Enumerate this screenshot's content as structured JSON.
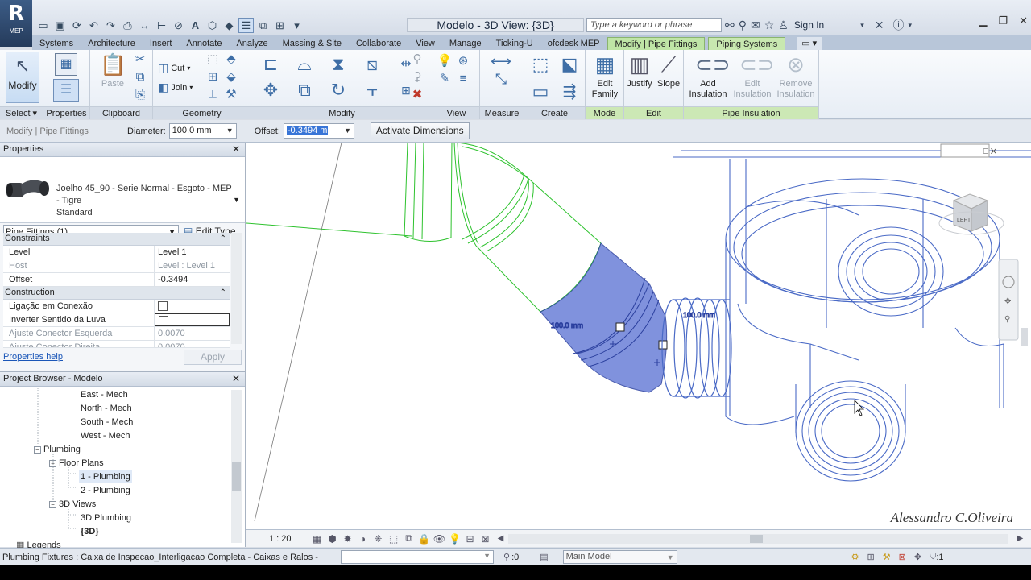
{
  "app": {
    "title": "Modelo - 3D View: {3D}",
    "logo_letter": "R",
    "logo_sub": "MEP",
    "search_placeholder": "Type a keyword or phrase",
    "sign_in": "Sign In"
  },
  "tabs": [
    "Systems",
    "Architecture",
    "Insert",
    "Annotate",
    "Analyze",
    "Massing & Site",
    "Collaborate",
    "View",
    "Manage",
    "Ticking-U",
    "ofcdesk MEP"
  ],
  "context_tabs": [
    "Modify | Pipe Fittings",
    "Piping Systems"
  ],
  "ribbon": {
    "select_panel": {
      "modify_label": "Modify",
      "title": "Select"
    },
    "properties_panel": {
      "title": "Properties"
    },
    "clipboard_panel": {
      "paste_label": "Paste",
      "title": "Clipboard"
    },
    "geometry_panel": {
      "cut_label": "Cut",
      "join_label": "Join",
      "title": "Geometry"
    },
    "modify_panel": {
      "title": "Modify"
    },
    "view_panel": {
      "title": "View"
    },
    "measure_panel": {
      "title": "Measure"
    },
    "create_panel": {
      "title": "Create"
    },
    "mode_panel": {
      "edit_family_label": "Edit Family",
      "title": "Mode"
    },
    "edit_panel": {
      "justify_label": "Justify",
      "slope_label": "Slope",
      "title": "Edit"
    },
    "insulation_panel": {
      "add_label": "Add Insulation",
      "edit_label": "Edit Insulation",
      "remove_label": "Remove Insulation",
      "title": "Pipe Insulation"
    }
  },
  "options_bar": {
    "context": "Modify | Pipe Fittings",
    "diameter_label": "Diameter:",
    "diameter_value": "100.0 mm",
    "offset_label": "Offset:",
    "offset_value": "-0.3494 m",
    "activate_dimensions": "Activate Dimensions"
  },
  "properties": {
    "header": "Properties",
    "type_name": "Joelho 45_90 - Serie Normal - Esgoto - MEP - Tigre",
    "type_sub": "Standard",
    "filter": "Pipe Fittings (1)",
    "edit_type": "Edit Type",
    "groups": [
      {
        "name": "Constraints",
        "rows": [
          {
            "k": "Level",
            "v": "Level 1",
            "grey": false
          },
          {
            "k": "Host",
            "v": "Level : Level 1",
            "grey": true
          },
          {
            "k": "Offset",
            "v": "-0.3494",
            "grey": false
          }
        ]
      },
      {
        "name": "Construction",
        "rows": [
          {
            "k": "Ligação em Conexão",
            "v": "",
            "check": true,
            "grey": false
          },
          {
            "k": "Inverter Sentido da Luva",
            "v": "",
            "check": true,
            "grey": false
          },
          {
            "k": "Ajuste Conector Esquerda",
            "v": "0.0070",
            "grey": true
          },
          {
            "k": "Ajuste Conector Direita",
            "v": "0.0070",
            "grey": true
          }
        ]
      }
    ],
    "help": "Properties help",
    "apply": "Apply"
  },
  "browser": {
    "header": "Project Browser - Modelo",
    "items": {
      "east": "East - Mech",
      "north": "North - Mech",
      "south": "South - Mech",
      "west": "West - Mech",
      "plumbing": "Plumbing",
      "floor_plans": "Floor Plans",
      "plumbing1": "1 - Plumbing",
      "plumbing2": "2 - Plumbing",
      "views3d": "3D Views",
      "plumbing3d": "3D Plumbing",
      "view3d": "{3D}",
      "legends": "Legends"
    }
  },
  "viewport": {
    "dim1": "100.0 mm",
    "dim2": "100.0 mm",
    "viewcube_label": "LEFT",
    "watermark": "Alessandro C.Oliveira",
    "scale": "1 : 20"
  },
  "status": {
    "text": "Plumbing Fixtures : Caixa de Inspecao_Interligacao Completa - Caixas e Ralos - I",
    "select_count": ":0",
    "workset": "Main Model",
    "filter_count": ":1"
  },
  "colors": {
    "selection": "#6a7fd8",
    "green_fitting": "#2ec22e",
    "model_lines": "#4a6ac6",
    "context_tab": "#bfe5a6"
  }
}
